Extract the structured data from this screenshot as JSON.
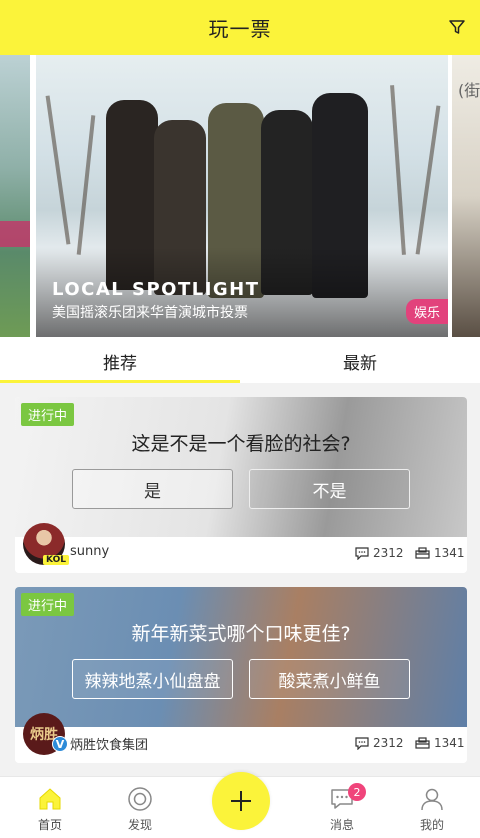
{
  "header": {
    "title": "玩一票",
    "filter_icon": "filter-icon"
  },
  "banner": {
    "title": "LOCAL SPOTLIGHT",
    "subtitle": "美国摇滚乐团来华首演城市投票",
    "tag": "娱乐",
    "right_peek_text": "(街",
    "tag_color": "#e2427c"
  },
  "tabs": [
    {
      "label": "推荐",
      "active": true
    },
    {
      "label": "最新",
      "active": false
    }
  ],
  "cards": [
    {
      "status": "进行中",
      "question": "这是不是一个看脸的社会?",
      "options": [
        "是",
        "不是"
      ],
      "author": "sunny",
      "author_badge": "KOL",
      "comments": "2312",
      "votes": "1341"
    },
    {
      "status": "进行中",
      "question": "新年新菜式哪个口味更佳?",
      "options": [
        "辣辣地蒸小仙盘盘",
        "酸菜煮小鲜鱼"
      ],
      "author": "炳胜饮食集团",
      "author_badge": "V",
      "avatar_text": "炳胜",
      "comments": "2312",
      "votes": "1341"
    }
  ],
  "bottom_nav": {
    "home": "首页",
    "discover": "发现",
    "messages": "消息",
    "messages_badge": "2",
    "mine": "我的"
  },
  "colors": {
    "accent": "#fbf33a",
    "status_green": "#7bc741",
    "badge_pink": "#f0447b"
  }
}
